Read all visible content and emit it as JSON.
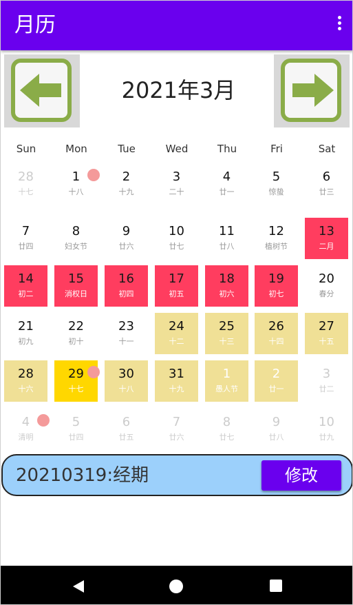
{
  "app_bar": {
    "title": "月历",
    "menu_icon": "more-vert-icon"
  },
  "calendar": {
    "month_title": "2021年3月",
    "prev_icon": "arrow-left-icon",
    "next_icon": "arrow-right-icon",
    "weekdays": [
      "Sun",
      "Mon",
      "Tue",
      "Wed",
      "Thu",
      "Fri",
      "Sat"
    ],
    "colors": {
      "period": "#ff3d5f",
      "predicted": "#f0e096",
      "today": "#ffd700",
      "marker_dot": "#f49a9a",
      "accent": "#6a00ee"
    },
    "weeks": [
      [
        {
          "day": "28",
          "lunar": "十七",
          "state": "other"
        },
        {
          "day": "1",
          "lunar": "十八",
          "state": "normal",
          "dot": true
        },
        {
          "day": "2",
          "lunar": "十九",
          "state": "normal"
        },
        {
          "day": "3",
          "lunar": "二十",
          "state": "normal"
        },
        {
          "day": "4",
          "lunar": "廿一",
          "state": "normal"
        },
        {
          "day": "5",
          "lunar": "惊蛰",
          "state": "normal"
        },
        {
          "day": "6",
          "lunar": "廿三",
          "state": "normal"
        }
      ],
      [
        {
          "day": "7",
          "lunar": "廿四",
          "state": "normal"
        },
        {
          "day": "8",
          "lunar": "妇女节",
          "state": "normal"
        },
        {
          "day": "9",
          "lunar": "廿六",
          "state": "normal"
        },
        {
          "day": "10",
          "lunar": "廿七",
          "state": "normal"
        },
        {
          "day": "11",
          "lunar": "廿八",
          "state": "normal"
        },
        {
          "day": "12",
          "lunar": "植树节",
          "state": "normal"
        },
        {
          "day": "13",
          "lunar": "二月",
          "state": "period"
        }
      ],
      [
        {
          "day": "14",
          "lunar": "初二",
          "state": "period"
        },
        {
          "day": "15",
          "lunar": "消权日",
          "state": "period"
        },
        {
          "day": "16",
          "lunar": "初四",
          "state": "period"
        },
        {
          "day": "17",
          "lunar": "初五",
          "state": "period"
        },
        {
          "day": "18",
          "lunar": "初六",
          "state": "period"
        },
        {
          "day": "19",
          "lunar": "初七",
          "state": "period"
        },
        {
          "day": "20",
          "lunar": "春分",
          "state": "normal"
        }
      ],
      [
        {
          "day": "21",
          "lunar": "初九",
          "state": "normal"
        },
        {
          "day": "22",
          "lunar": "初十",
          "state": "normal"
        },
        {
          "day": "23",
          "lunar": "十一",
          "state": "normal"
        },
        {
          "day": "24",
          "lunar": "十二",
          "state": "predicted"
        },
        {
          "day": "25",
          "lunar": "十三",
          "state": "predicted"
        },
        {
          "day": "26",
          "lunar": "十四",
          "state": "predicted"
        },
        {
          "day": "27",
          "lunar": "十五",
          "state": "predicted"
        }
      ],
      [
        {
          "day": "28",
          "lunar": "十六",
          "state": "predicted"
        },
        {
          "day": "29",
          "lunar": "十七",
          "state": "today",
          "dot": true
        },
        {
          "day": "30",
          "lunar": "十八",
          "state": "predicted"
        },
        {
          "day": "31",
          "lunar": "十九",
          "state": "predicted"
        },
        {
          "day": "1",
          "lunar": "愚人节",
          "state": "predicted-other"
        },
        {
          "day": "2",
          "lunar": "廿一",
          "state": "predicted-other"
        },
        {
          "day": "3",
          "lunar": "廿二",
          "state": "other"
        }
      ],
      [
        {
          "day": "4",
          "lunar": "清明",
          "state": "other",
          "dot": true
        },
        {
          "day": "5",
          "lunar": "廿四",
          "state": "other"
        },
        {
          "day": "6",
          "lunar": "廿五",
          "state": "other"
        },
        {
          "day": "7",
          "lunar": "廿六",
          "state": "other"
        },
        {
          "day": "8",
          "lunar": "廿七",
          "state": "other"
        },
        {
          "day": "9",
          "lunar": "廿八",
          "state": "other"
        },
        {
          "day": "10",
          "lunar": "廿九",
          "state": "other"
        }
      ]
    ]
  },
  "note": {
    "text": "20210319:经期",
    "edit_label": "修改"
  },
  "system_nav": {
    "back_icon": "back-triangle-icon",
    "home_icon": "home-circle-icon",
    "recents_icon": "recents-square-icon"
  }
}
